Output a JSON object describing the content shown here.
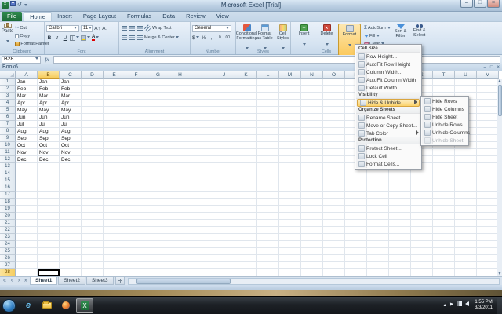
{
  "window": {
    "title": "Microsoft Excel [Trial]"
  },
  "icons": {
    "sigma": "Σ",
    "fx": "fx",
    "scissors": "✂",
    "undo": "↺",
    "minimize": "–",
    "maximize": "□",
    "close": "×",
    "show_hidden": "▴",
    "flag": "⚑",
    "first_sheet": "«",
    "prev_sheet": "‹",
    "next_sheet": "›",
    "last_sheet": "»"
  },
  "ribbon_tabs": [
    {
      "label": "File",
      "type": "file"
    },
    {
      "label": "Home",
      "active": true
    },
    {
      "label": "Insert"
    },
    {
      "label": "Page Layout"
    },
    {
      "label": "Formulas"
    },
    {
      "label": "Data"
    },
    {
      "label": "Review"
    },
    {
      "label": "View"
    }
  ],
  "ribbon": {
    "clipboard": {
      "label": "Clipboard",
      "paste": "Paste",
      "cut": "Cut",
      "copy": "Copy",
      "format_painter": "Format Painter"
    },
    "font": {
      "label": "Font",
      "name": "Calibri",
      "size": "11",
      "bold": "B",
      "italic": "I",
      "underline": "U",
      "grow": "A",
      "shrink": "A"
    },
    "alignment": {
      "label": "Alignment",
      "wrap": "Wrap Text",
      "merge": "Merge & Center"
    },
    "number": {
      "label": "Number",
      "format": "General",
      "currency": "$",
      "percent": "%",
      "comma": ",",
      "inc_dec": ".0",
      "dec_dec": ".00"
    },
    "styles": {
      "label": "Styles",
      "items": [
        "Conditional Formatting",
        "Format as Table",
        "Cell Styles"
      ]
    },
    "cells": {
      "label": "Cells",
      "items": [
        "Insert",
        "Delete",
        "Format"
      ],
      "active_item": "Format"
    },
    "editing": {
      "label": "Editing",
      "autosum": "AutoSum",
      "fill": "Fill",
      "clear": "Clear",
      "sort": "Sort & Filter",
      "find": "Find & Select"
    }
  },
  "formula_bar": {
    "name_box": "B28"
  },
  "workbook": {
    "name": "Book6"
  },
  "grid": {
    "columns": [
      "A",
      "B",
      "C",
      "D",
      "E",
      "F",
      "G",
      "H",
      "I",
      "J",
      "K",
      "L",
      "M",
      "N",
      "O",
      "P",
      "Q",
      "R",
      "S",
      "T",
      "U",
      "V"
    ],
    "row_count": 28,
    "months": [
      "Jan",
      "Feb",
      "Mar",
      "Apr",
      "May",
      "Jun",
      "Jul",
      "Aug",
      "Sep",
      "Oct",
      "Nov",
      "Dec"
    ],
    "month_columns": [
      0,
      1,
      2
    ],
    "selected": {
      "col": 1,
      "row": 28
    }
  },
  "format_menu": {
    "sections": [
      {
        "header": "Cell Size",
        "items": [
          {
            "label": "Row Height..."
          },
          {
            "label": "AutoFit Row Height"
          },
          {
            "label": "Column Width..."
          },
          {
            "label": "AutoFit Column Width"
          },
          {
            "label": "Default Width..."
          }
        ]
      },
      {
        "header": "Visibility",
        "items": [
          {
            "label": "Hide & Unhide",
            "submenu": true,
            "highlighted": true
          }
        ]
      },
      {
        "header": "Organize Sheets",
        "items": [
          {
            "label": "Rename Sheet"
          },
          {
            "label": "Move or Copy Sheet..."
          },
          {
            "label": "Tab Color",
            "submenu": true
          }
        ]
      },
      {
        "header": "Protection",
        "items": [
          {
            "label": "Protect Sheet..."
          },
          {
            "label": "Lock Cell"
          },
          {
            "label": "Format Cells..."
          }
        ]
      }
    ],
    "submenu": {
      "items": [
        {
          "label": "Hide Rows"
        },
        {
          "label": "Hide Columns"
        },
        {
          "label": "Hide Sheet"
        },
        {
          "label": "Unhide Rows"
        },
        {
          "label": "Unhide Columns"
        },
        {
          "label": "Unhide Sheet",
          "disabled": true
        }
      ]
    }
  },
  "sheet_bar": {
    "tabs": [
      "Sheet1",
      "Sheet2",
      "Sheet3"
    ],
    "active_index": 0
  },
  "taskbar": {
    "time": "1:55 PM",
    "date": "3/3/2011"
  }
}
